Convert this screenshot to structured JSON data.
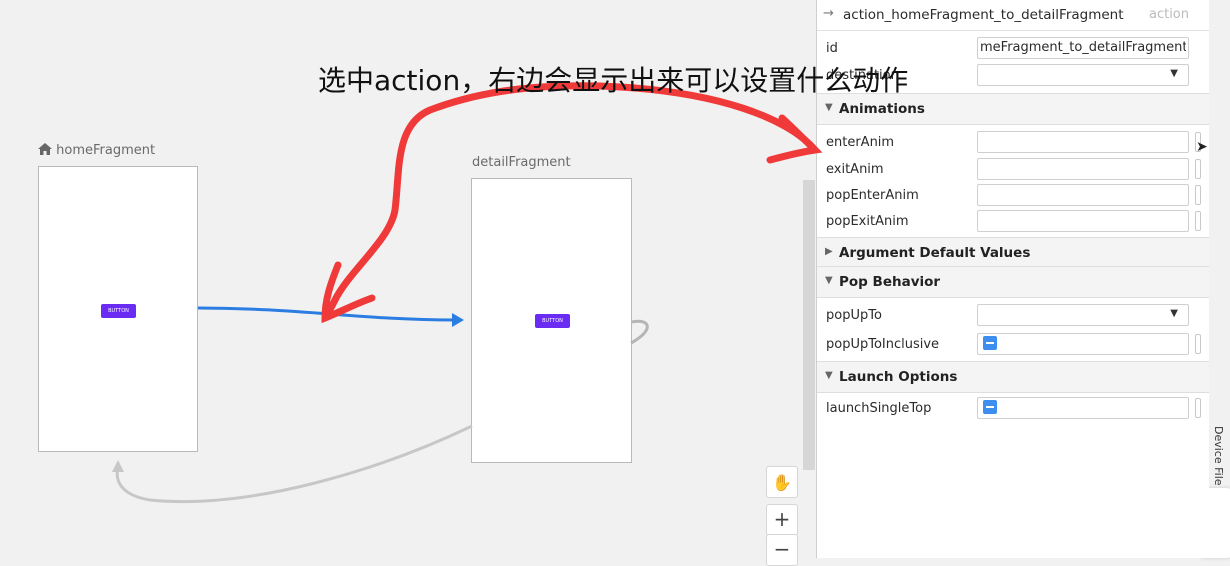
{
  "annotation": {
    "text": "选中action，右边会显示出来可以设置什么动作",
    "ink_color": "#f03a3a"
  },
  "canvas": {
    "home": {
      "label": "homeFragment",
      "icon": "home-icon",
      "button_label": "BUTTON"
    },
    "detail": {
      "label": "detailFragment",
      "button_label": "BUTTON"
    },
    "action_color": "#2b7de2",
    "zoom": {
      "hand": "✋",
      "plus": "+",
      "minus": "−"
    }
  },
  "panel": {
    "header": {
      "arrow": "→",
      "title": "action_homeFragment_to_detailFragment",
      "type": "action"
    },
    "id": {
      "label": "id",
      "value": "meFragment_to_detailFragment"
    },
    "destination": {
      "label": "destination",
      "value": ""
    },
    "sections": {
      "animations": "Animations",
      "argument_defaults": "Argument Default Values",
      "pop_behavior": "Pop Behavior",
      "launch_options": "Launch Options"
    },
    "anim": {
      "enter": {
        "label": "enterAnim",
        "value": ""
      },
      "exit": {
        "label": "exitAnim",
        "value": ""
      },
      "pop_enter": {
        "label": "popEnterAnim",
        "value": ""
      },
      "pop_exit": {
        "label": "popExitAnim",
        "value": ""
      }
    },
    "pop": {
      "up_to": {
        "label": "popUpTo",
        "value": ""
      },
      "inclusive": {
        "label": "popUpToInclusive"
      }
    },
    "launch": {
      "single_top": {
        "label": "launchSingleTop"
      }
    }
  },
  "side": {
    "device_tab": "Device File Explorer"
  },
  "colors": {
    "toggle": "#3d8ef0",
    "button": "#6a2cf2"
  }
}
